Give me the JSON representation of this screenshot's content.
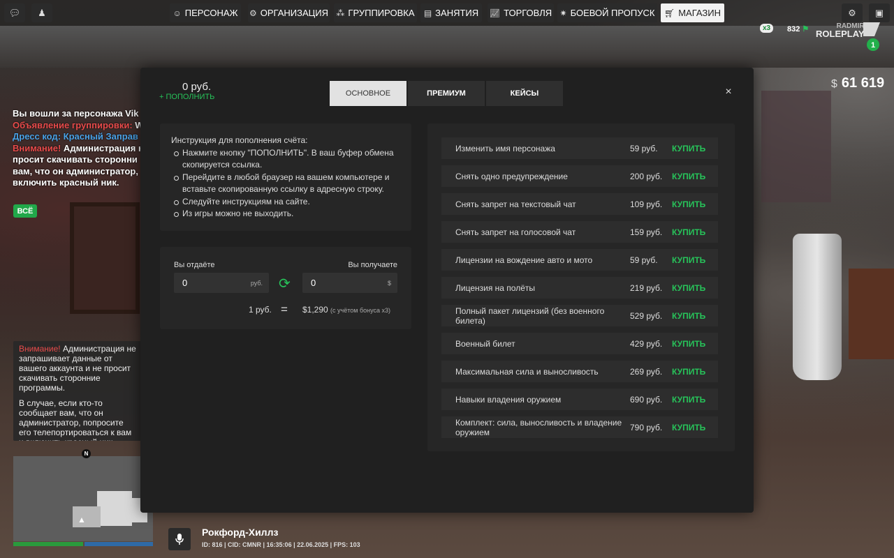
{
  "top_bar": {
    "left_icons": [
      "chat-icon",
      "character-icon"
    ],
    "nav": [
      {
        "icon": "person-icon",
        "label": "ПЕРСОНАЖ"
      },
      {
        "icon": "organization-icon",
        "label": "ОРГАНИЗАЦИЯ"
      },
      {
        "icon": "group-icon",
        "label": "ГРУППИРОВКА"
      },
      {
        "icon": "tasks-icon",
        "label": "ЗАНЯТИЯ"
      },
      {
        "icon": "chart-icon",
        "label": "ТОРГОВЛЯ"
      },
      {
        "icon": "battlepass-icon",
        "label": "БОЕВОЙ ПРОПУСК"
      },
      {
        "icon": "cart-icon",
        "label": "МАГАЗИН"
      }
    ],
    "right_icons": [
      "settings-icon",
      "inventory-icon"
    ]
  },
  "hud": {
    "multiplier": "x3",
    "online": "832",
    "logo_line1": "RADMIR",
    "logo_line2": "ROLEPLAY",
    "server_number": "1",
    "money_currency": "$",
    "money": "61 619"
  },
  "chat": {
    "lines": [
      {
        "prefix": "",
        "text": "Вы вошли за персонажа Vik"
      },
      {
        "prefix": "Объявление группировки:",
        "text": " W"
      },
      {
        "prefix": "Дресс код: Красный Заправ",
        "text": ""
      },
      {
        "prefix": "Внимание!",
        "text": " Администрация н"
      },
      {
        "prefix": "",
        "text": "просит скачивать сторонни"
      },
      {
        "prefix": "",
        "text": "вам, что он администратор,"
      },
      {
        "prefix": "",
        "text": "включить красный ник."
      }
    ],
    "all_button": "ВСЁ"
  },
  "notice": {
    "warning": "Внимание!",
    "p1": " Администрация не запрашивает данные от вашего аккаунта и не просит скачивать сторонние программы.",
    "p2": "В случае, если кто-то сообщает вам, что он администратор, попросите его телепортироваться к вам и включить красный ник."
  },
  "minimap": {
    "compass": "N"
  },
  "location": {
    "name": "Рокфорд-Хиллз",
    "info": "ID: 816 | CID: CMNR | 16:35:06 | 22.06.2025 | FPS: 103"
  },
  "shop": {
    "balance": "0 руб.",
    "topup": "+ ПОПОЛНИТЬ",
    "tabs": [
      "ОСНОВНОЕ",
      "ПРЕМИУМ",
      "КЕЙСЫ"
    ],
    "close": "×",
    "instructions": {
      "title": "Инструкция для пополнения счёта:",
      "steps": [
        "Нажмите кнопку \"ПОПОЛНИТЬ\". В ваш буфер обмена скопируется ссылка.",
        "Перейдите в любой браузер на вашем компьютере и вставьте скопированную ссылку в адресную строку.",
        "Следуйте инструкциям на сайте.",
        "Из игры можно не выходить."
      ]
    },
    "exchange": {
      "give_label": "Вы отдаёте",
      "get_label": "Вы получаете",
      "give_value": "0",
      "give_currency": "руб.",
      "get_value": "0",
      "get_currency": "$",
      "rate_left": "1 руб.",
      "rate_eq": "=",
      "rate_right": "$1,290",
      "bonus": "(с учётом бонуса x3)"
    },
    "buy_label": "КУПИТЬ",
    "items": [
      {
        "name": "Изменить имя персонажа",
        "price": "59 руб."
      },
      {
        "name": "Снять одно предупреждение",
        "price": "200 руб."
      },
      {
        "name": "Снять запрет на текстовый чат",
        "price": "109 руб."
      },
      {
        "name": "Снять запрет на голосовой чат",
        "price": "159 руб."
      },
      {
        "name": "Лицензии на вождение авто и мото",
        "price": "59 руб."
      },
      {
        "name": "Лицензия на полёты",
        "price": "219 руб."
      },
      {
        "name": "Полный пакет лицензий (без военного билета)",
        "price": "529 руб."
      },
      {
        "name": "Военный билет",
        "price": "429 руб."
      },
      {
        "name": "Максимальная сила и выносливость",
        "price": "269 руб."
      },
      {
        "name": "Навыки владения оружием",
        "price": "690 руб."
      },
      {
        "name": "Комплект: сила, выносливость и владение оружием",
        "price": "790 руб."
      }
    ]
  }
}
